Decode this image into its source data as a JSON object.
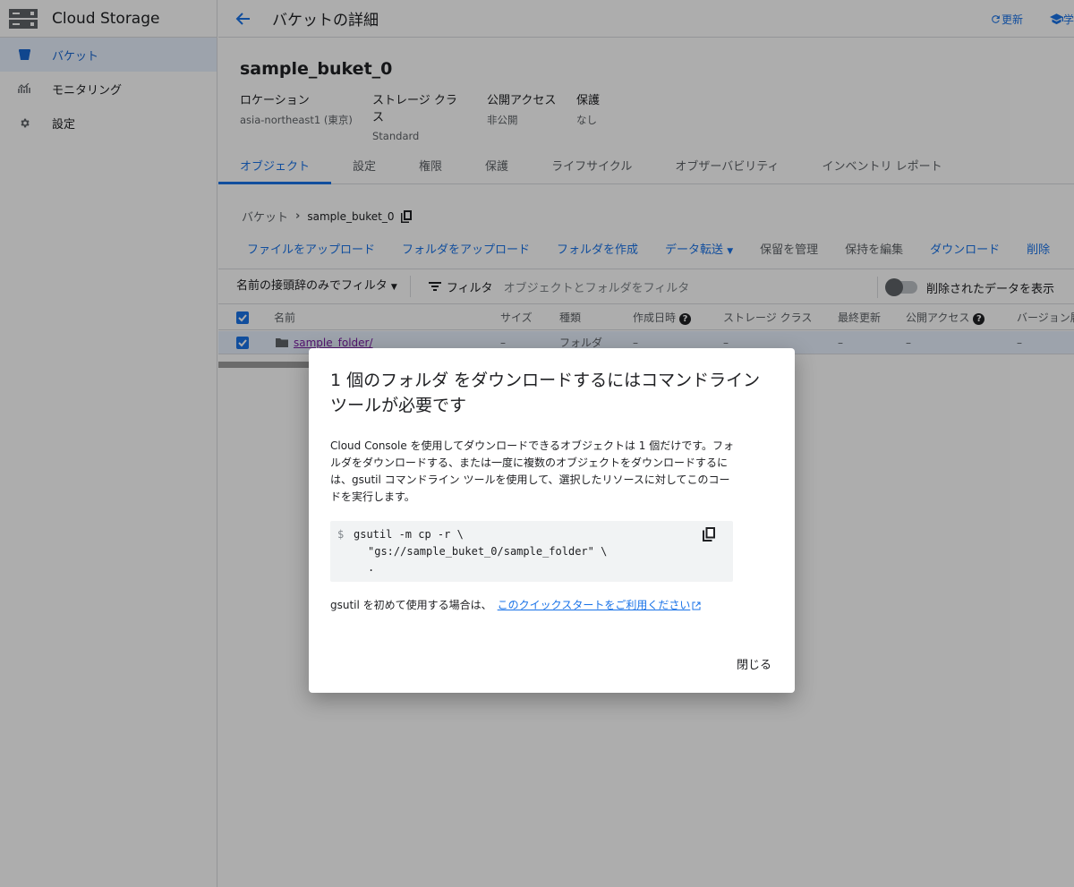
{
  "sidebar": {
    "title": "Cloud Storage",
    "items": [
      {
        "label": "バケット",
        "icon": "bucket-icon"
      },
      {
        "label": "モニタリング",
        "icon": "monitoring-icon"
      },
      {
        "label": "設定",
        "icon": "gear-icon"
      }
    ]
  },
  "topbar": {
    "title": "バケットの詳細",
    "refresh_label": "更新",
    "learn_label": "学"
  },
  "bucket": {
    "name": "sample_buket_0",
    "props": [
      {
        "label": "ロケーション",
        "value": "asia-northeast1 (東京)"
      },
      {
        "label": "ストレージ クラス",
        "value": "Standard"
      },
      {
        "label": "公開アクセス",
        "value": "非公開"
      },
      {
        "label": "保護",
        "value": "なし"
      }
    ]
  },
  "tabs": [
    "オブジェクト",
    "設定",
    "権限",
    "保護",
    "ライフサイクル",
    "オブザーバビリティ",
    "インベントリ レポート"
  ],
  "breadcrumb": {
    "root": "バケット",
    "current": "sample_buket_0"
  },
  "actions": [
    "ファイルをアップロード",
    "フォルダをアップロード",
    "フォルダを作成",
    "データ転送",
    "保留を管理",
    "保持を編集",
    "ダウンロード",
    "削除"
  ],
  "filter": {
    "prefix_label": "名前の接頭辞のみでフィルタ",
    "filter_label": "フィルタ",
    "placeholder": "オブジェクトとフォルダをフィルタ",
    "show_deleted_label": "削除されたデータを表示"
  },
  "table": {
    "columns": [
      "名前",
      "サイズ",
      "種類",
      "作成日時",
      "ストレージ クラス",
      "最終更新",
      "公開アクセス",
      "バージョン履"
    ],
    "rows": [
      {
        "name": "sample_folder/",
        "size": "–",
        "type": "フォルダ",
        "created": "–",
        "storage_class": "–",
        "updated": "–",
        "public": "–",
        "version": "–"
      }
    ]
  },
  "dialog": {
    "title": "1 個のフォルダ をダウンロードするにはコマンドライン ツールが必要です",
    "body": "Cloud Console を使用してダウンロードできるオブジェクトは 1 個だけです。フォルダをダウンロードする、または一度に複数のオブジェクトをダウンロードするには、gsutil コマンドライン ツールを使用して、選択したリソースに対してこのコードを実行します。",
    "code": {
      "prompt": "$",
      "line1": "gsutil -m cp -r \\",
      "line2": "\"gs://sample_buket_0/sample_folder\" \\",
      "line3": "."
    },
    "footer_text": "gsutil を初めて使用する場合は、",
    "footer_link": "このクイックスタートをご利用ください",
    "close_label": "閉じる"
  }
}
